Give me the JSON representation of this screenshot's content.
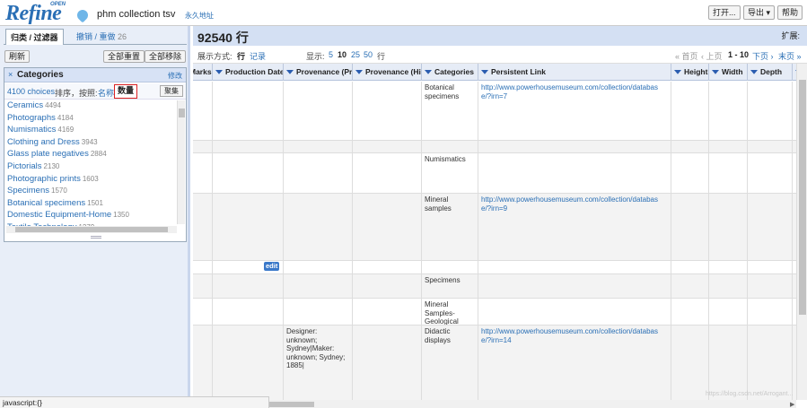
{
  "header": {
    "logo_text": "Refine",
    "logo_badge": "OPEN",
    "project_title": "phm collection tsv",
    "permalink": "永久地址",
    "open_button": "打开...",
    "export_button": "导出 ▾",
    "help_button": "帮助"
  },
  "left_panel": {
    "tab_facet": "归类 / 过滤器",
    "tab_undo": "撤销 / 重做",
    "tab_undo_count": "26",
    "refresh_button": "刷新",
    "reset_all_button": "全部重置",
    "remove_all_button": "全部移除",
    "facet": {
      "close": "×",
      "title": "Categories",
      "edit": "修改",
      "choices": "4100 choices",
      "sort_by": "排序，按照:",
      "sort_name": "名称",
      "sort_count": "数量",
      "cluster_button": "聚集",
      "items": [
        {
          "label": "Ceramics",
          "count": "4494"
        },
        {
          "label": "Photographs",
          "count": "4184"
        },
        {
          "label": "Numismatics",
          "count": "4169"
        },
        {
          "label": "Clothing and Dress",
          "count": "3943"
        },
        {
          "label": "Glass plate negatives",
          "count": "2884"
        },
        {
          "label": "Pictorials",
          "count": "2130"
        },
        {
          "label": "Photographic prints",
          "count": "1603"
        },
        {
          "label": "Specimens",
          "count": "1570"
        },
        {
          "label": "Botanical specimens",
          "count": "1501"
        },
        {
          "label": "Domestic Equipment-Home",
          "count": "1350"
        },
        {
          "label": "Textile Technology",
          "count": "1279"
        }
      ]
    }
  },
  "main": {
    "row_count": "92540 行",
    "extend_label": "扩展:",
    "view_label": "展示方式:",
    "view_rows": "行",
    "view_records": "记录",
    "show_label": "显示:",
    "page_sizes": [
      "5",
      "10",
      "25",
      "50"
    ],
    "page_size_unit": "行",
    "first_page": "« 首页",
    "prev_page": "‹ 上页",
    "page_range": "1 - 10",
    "next_page": "下页 ›",
    "last_page": "末页 »",
    "columns": [
      "Marks",
      "Production Date",
      "Provenance (Production)",
      "Provenance (History)",
      "Categories",
      "Persistent Link",
      "Height",
      "Width",
      "Depth",
      "D"
    ],
    "rows": [
      {
        "provenance": "",
        "category": "Botanical specimens",
        "link": "http://www.powerhousemuseum.com/collection/database/?irn=7"
      },
      {
        "provenance": "",
        "category": "",
        "link": ""
      },
      {
        "provenance": "",
        "category": "Numismatics",
        "link": ""
      },
      {
        "provenance": "",
        "category": "Mineral samples",
        "link": "http://www.powerhousemuseum.com/collection/database/?irn=9"
      },
      {
        "provenance": "",
        "category": "",
        "link": ""
      },
      {
        "provenance": "",
        "category": "Specimens",
        "link": ""
      },
      {
        "provenance": "",
        "category": "Mineral Samples-Geological",
        "link": ""
      },
      {
        "provenance": "Designer: unknown; Sydney|Maker: unknown; Sydney; 1885|",
        "category": "Didactic displays",
        "link": "http://www.powerhousemuseum.com/collection/database/?irn=14"
      }
    ],
    "edit_tag": "edit"
  },
  "status_bar": "javascript:{}",
  "watermark": "https://blog.csdn.net/Arrogant..."
}
